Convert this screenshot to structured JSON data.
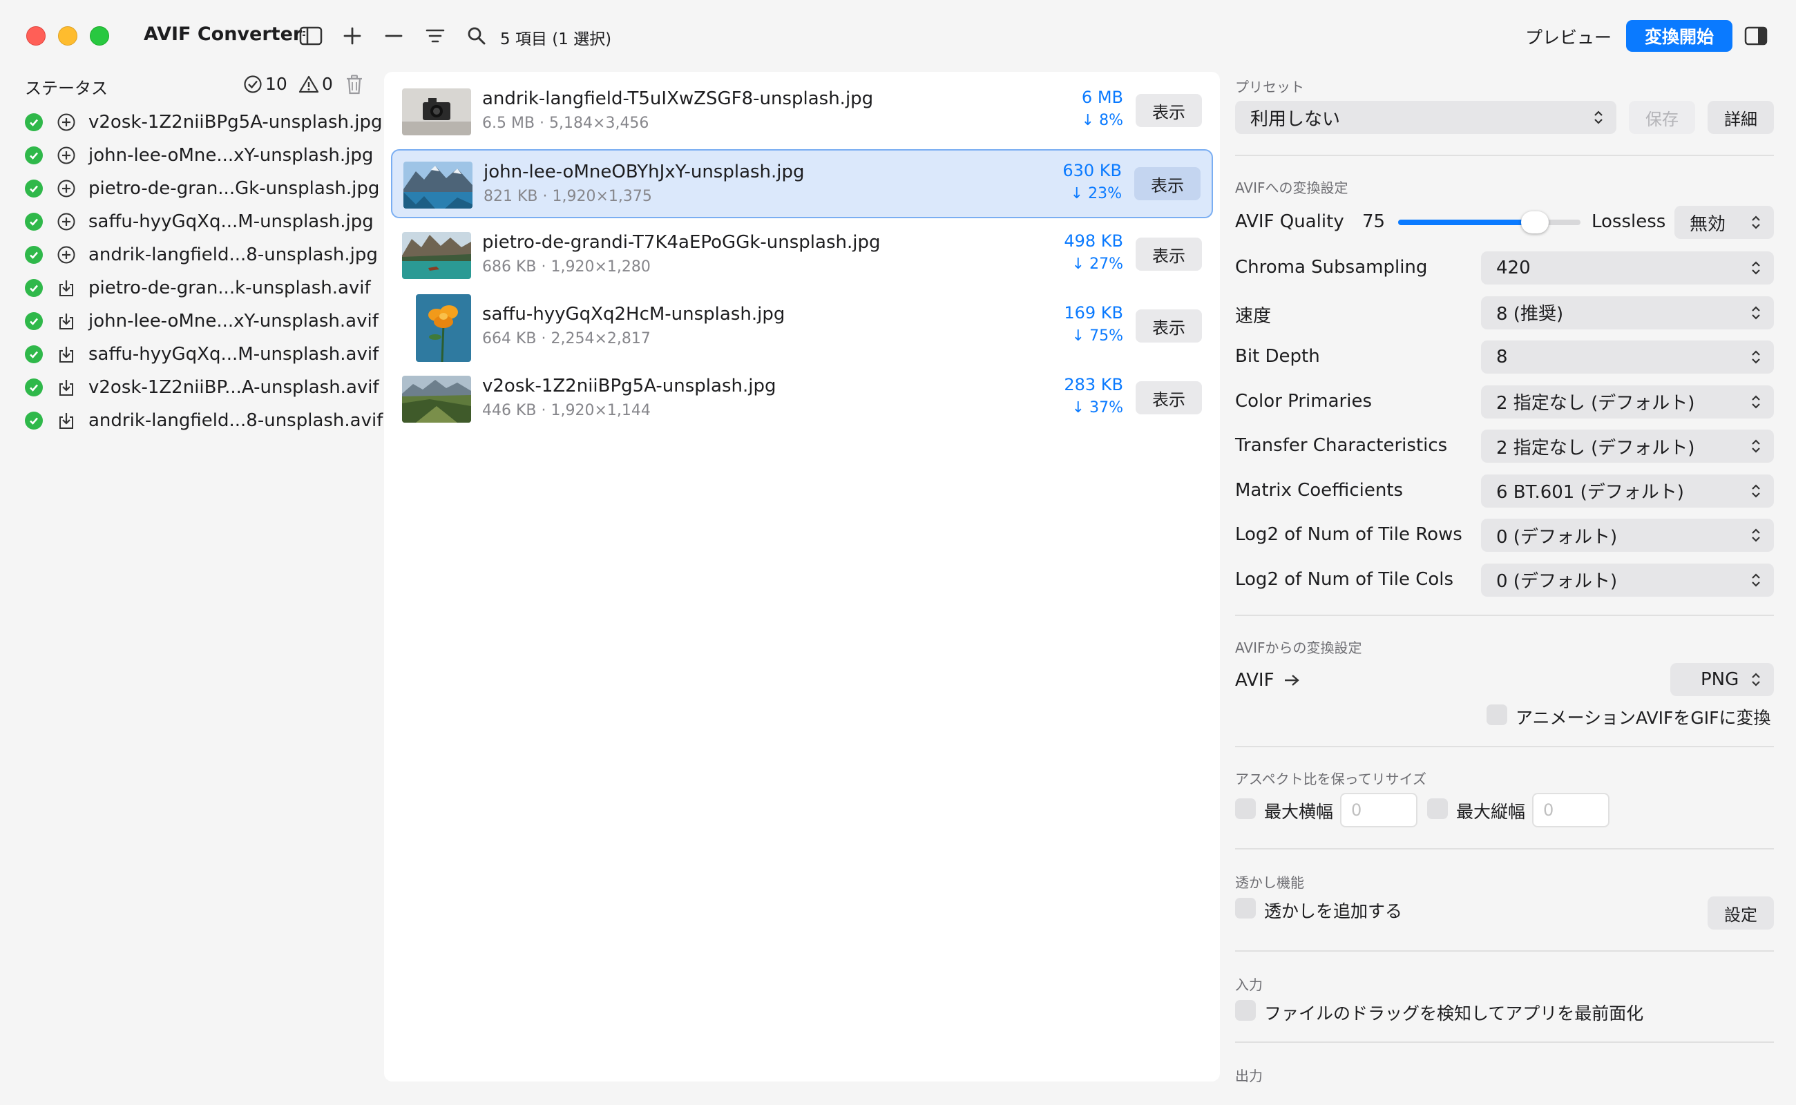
{
  "window": {
    "title": "AVIF Converter",
    "item_count": "5 項目 (1 選択)",
    "preview_label": "プレビュー",
    "start_label": "変換開始"
  },
  "sidebar": {
    "header": "ステータス",
    "success_count": "10",
    "warning_count": "0",
    "items": [
      {
        "name": "v2osk-1Z2niiBPg5A-unsplash.jpg",
        "kind": "add"
      },
      {
        "name": "john-lee-oMne...xY-unsplash.jpg",
        "kind": "add"
      },
      {
        "name": "pietro-de-gran...Gk-unsplash.jpg",
        "kind": "add"
      },
      {
        "name": "saffu-hyyGqXq...M-unsplash.jpg",
        "kind": "add"
      },
      {
        "name": "andrik-langfield...8-unsplash.jpg",
        "kind": "add"
      },
      {
        "name": "pietro-de-gran...k-unsplash.avif",
        "kind": "export"
      },
      {
        "name": "john-lee-oMne...xY-unsplash.avif",
        "kind": "export"
      },
      {
        "name": "saffu-hyyGqXq...M-unsplash.avif",
        "kind": "export"
      },
      {
        "name": "v2osk-1Z2niiBP...A-unsplash.avif",
        "kind": "export"
      },
      {
        "name": "andrik-langfield...8-unsplash.avif",
        "kind": "export"
      }
    ]
  },
  "files": [
    {
      "name": "andrik-langfield-T5uIXwZSGF8-unsplash.jpg",
      "meta": "6.5 MB · 5,184×3,456",
      "size": "6 MB",
      "reduction": "↓ 8%",
      "show": "表示",
      "selected": false
    },
    {
      "name": "john-lee-oMneOBYhJxY-unsplash.jpg",
      "meta": "821 KB · 1,920×1,375",
      "size": "630 KB",
      "reduction": "↓ 23%",
      "show": "表示",
      "selected": true
    },
    {
      "name": "pietro-de-grandi-T7K4aEPoGGk-unsplash.jpg",
      "meta": "686 KB · 1,920×1,280",
      "size": "498 KB",
      "reduction": "↓ 27%",
      "show": "表示",
      "selected": false
    },
    {
      "name": "saffu-hyyGqXq2HcM-unsplash.jpg",
      "meta": "664 KB · 2,254×2,817",
      "size": "169 KB",
      "reduction": "↓ 75%",
      "show": "表示",
      "selected": false
    },
    {
      "name": "v2osk-1Z2niiBPg5A-unsplash.jpg",
      "meta": "446 KB · 1,920×1,144",
      "size": "283 KB",
      "reduction": "↓ 37%",
      "show": "表示",
      "selected": false
    }
  ],
  "panel": {
    "preset": {
      "label": "プリセット",
      "value": "利用しない",
      "save": "保存",
      "detail": "詳細"
    },
    "to_avif": {
      "label": "AVIFへの変換設定",
      "quality_label": "AVIF Quality",
      "quality_value": "75",
      "quality_fraction": 0.75,
      "lossless_label": "Lossless",
      "lossless_value": "無効",
      "rows": [
        {
          "label": "Chroma Subsampling",
          "value": "420"
        },
        {
          "label": "速度",
          "value": "8 (推奨)"
        },
        {
          "label": "Bit Depth",
          "value": "8"
        },
        {
          "label": "Color Primaries",
          "value": "2  指定なし (デフォルト)"
        },
        {
          "label": "Transfer Characteristics",
          "value": "2  指定なし (デフォルト)"
        },
        {
          "label": "Matrix Coefficients",
          "value": "6  BT.601 (デフォルト)"
        },
        {
          "label": "Log2 of Num of Tile Rows",
          "value": "0 (デフォルト)"
        },
        {
          "label": "Log2 of Num of Tile Cols",
          "value": "0 (デフォルト)"
        }
      ]
    },
    "from_avif": {
      "label": "AVIFからの変換設定",
      "avif_label": "AVIF",
      "format": "PNG",
      "anim_label": "アニメーションAVIFをGIFに変換"
    },
    "resize": {
      "label": "アスペクト比を保ってリサイズ",
      "max_width": "最大横幅",
      "max_height": "最大縦幅",
      "width_placeholder": "0",
      "height_placeholder": "0"
    },
    "watermark": {
      "label": "透かし機能",
      "add_label": "透かしを追加する",
      "settings": "設定"
    },
    "input": {
      "label": "入力",
      "drag_label": "ファイルのドラッグを検知してアプリを最前面化"
    },
    "output": {
      "label": "出力"
    }
  }
}
